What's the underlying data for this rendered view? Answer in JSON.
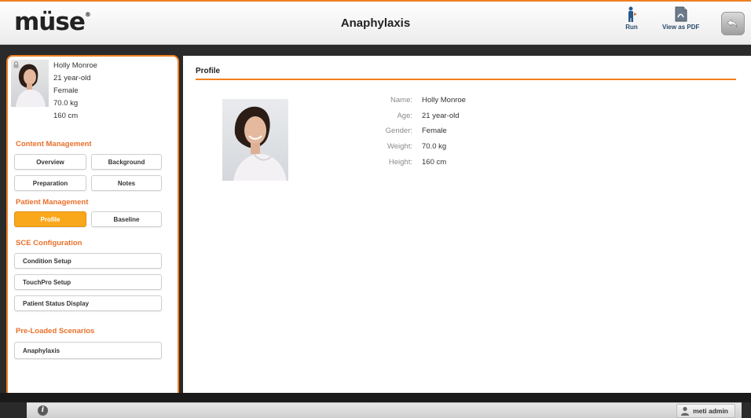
{
  "header": {
    "logo": "müse",
    "logo_mark": "®",
    "title": "Anaphylaxis",
    "run_label": "Run",
    "pdf_label": "View as PDF"
  },
  "patient": {
    "name": "Holly Monroe",
    "age": "21 year-old",
    "gender": "Female",
    "weight": "70.0 kg",
    "height": "160 cm"
  },
  "sidebar": {
    "content_management": {
      "heading": "Content Management",
      "overview": "Overview",
      "background": "Background",
      "preparation": "Preparation",
      "notes": "Notes"
    },
    "patient_management": {
      "heading": "Patient Management",
      "profile": "Profile",
      "baseline": "Baseline"
    },
    "sce_configuration": {
      "heading": "SCE Configuration",
      "condition_setup": "Condition Setup",
      "touchpro_setup": "TouchPro Setup",
      "patient_status_display": "Patient Status Display"
    },
    "preloaded": {
      "heading": "Pre-Loaded Scenarios",
      "anaphylaxis": "Anaphylaxis"
    }
  },
  "main": {
    "heading": "Profile",
    "fields": [
      {
        "label": "Name:",
        "value": "Holly Monroe"
      },
      {
        "label": "Age:",
        "value": "21 year-old"
      },
      {
        "label": "Gender:",
        "value": "Female"
      },
      {
        "label": "Weight:",
        "value": "70.0 kg"
      },
      {
        "label": "Height:",
        "value": "160 cm"
      }
    ]
  },
  "status_bar": {
    "info_icon": "i",
    "user": "meti admin"
  },
  "colors": {
    "accent": "#f07f21",
    "active_button": "#f9a81b",
    "section_heading": "#e8702a"
  },
  "icons": [
    "lock-icon",
    "run-icon",
    "pdf-icon",
    "back-arrow-icon",
    "info-icon",
    "user-icon"
  ]
}
